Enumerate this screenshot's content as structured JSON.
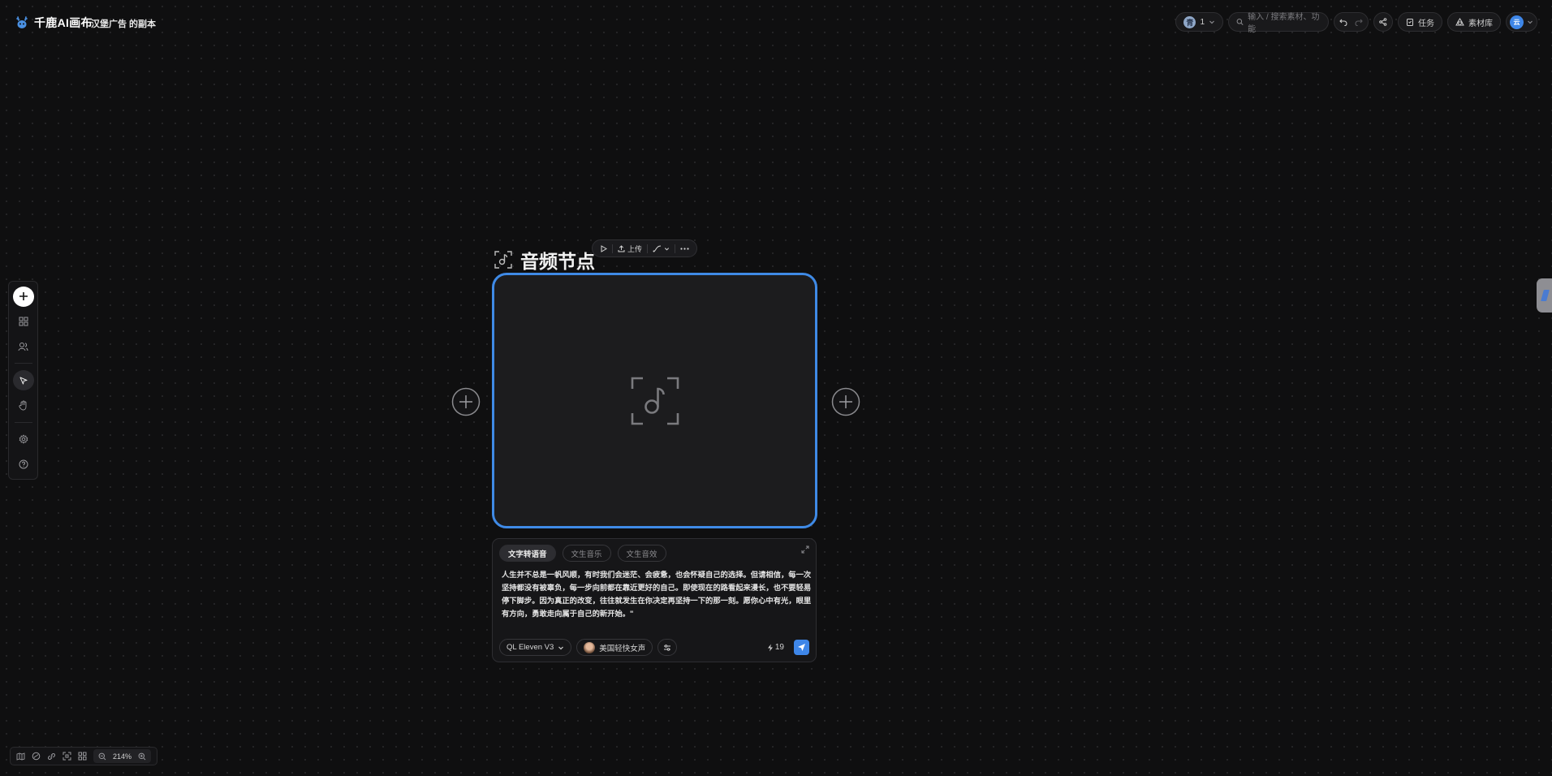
{
  "brand": {
    "name": "千鹿AI画布"
  },
  "project": {
    "name": "汉堡广告 的副本"
  },
  "topbar": {
    "team_initial": "青",
    "team_count": "1",
    "search_placeholder": "输入 / 搜索素材、功能",
    "tasks_label": "任务",
    "assets_label": "素材库",
    "user_initial": "云"
  },
  "node": {
    "title": "音频节点",
    "toolbar": {
      "upload_label": "上传"
    }
  },
  "prompt_panel": {
    "tabs": [
      {
        "label": "文字转语音",
        "active": true
      },
      {
        "label": "文生音乐",
        "active": false
      },
      {
        "label": "文生音效",
        "active": false
      }
    ],
    "text": "人生并不总是一帆风顺，有时我们会迷茫、会疲惫，也会怀疑自己的选择。但请相信，每一次坚持都没有被辜负，每一步向前都在靠近更好的自己。即使现在的路看起来漫长，也不要轻易停下脚步。因为真正的改变，往往就发生在你决定再坚持一下的那一刻。愿你心中有光，眼里有方向，勇敢走向属于自己的新开始。\"",
    "model": "QL Eleven V3",
    "voice": "美国轻快女声",
    "cost": "19"
  },
  "zoom": {
    "level": "214%"
  },
  "colors": {
    "accent": "#3e86e8",
    "background": "#0f0f10"
  }
}
